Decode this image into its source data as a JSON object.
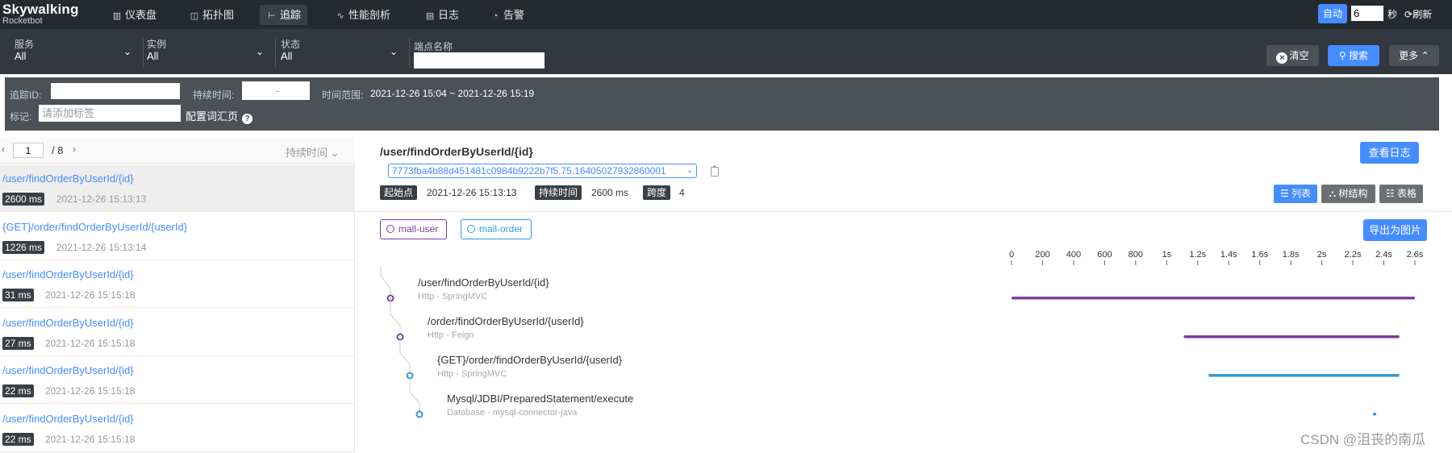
{
  "app": {
    "logo_line1": "Skywalking",
    "logo_line2": "Rocketbot"
  },
  "nav": [
    {
      "icon": "dashboard-icon",
      "glyph": "▥",
      "label": "仪表盘",
      "active": false
    },
    {
      "icon": "topology-icon",
      "glyph": "◫",
      "label": "拓扑图",
      "active": false
    },
    {
      "icon": "trace-icon",
      "glyph": "⊢",
      "label": "追踪",
      "active": true
    },
    {
      "icon": "profile-icon",
      "glyph": "∿",
      "label": "性能剖析",
      "active": false
    },
    {
      "icon": "log-icon",
      "glyph": "▤",
      "label": "日志",
      "active": false
    },
    {
      "icon": "alarm-icon",
      "glyph": "◔",
      "label": "告警",
      "active": false
    }
  ],
  "topright": {
    "auto_label": "自动",
    "interval_value": "6",
    "sec_label": "秒",
    "refresh_label": "刷新"
  },
  "filters": {
    "service": {
      "label": "服务",
      "value": "All"
    },
    "instance": {
      "label": "实例",
      "value": "All"
    },
    "status": {
      "label": "状态",
      "value": "All"
    },
    "endpoint_label": "端点名称",
    "endpoint_value": "",
    "clear_label": "清空",
    "search_label": "搜索",
    "more_label": "更多"
  },
  "advanced": {
    "trace_id_label": "追踪ID:",
    "trace_id_value": "",
    "duration_label": "持续时间:",
    "duration_placeholder": "-",
    "time_range_label": "时间范围:",
    "time_range_value": "2021-12-26 15:04 ~ 2021-12-26 15:19",
    "tags_label": "标记:",
    "tags_placeholder": "请添加标签",
    "config_link": "配置词汇页"
  },
  "list": {
    "page": "1",
    "total": "/ 8",
    "sort_label": "持续时间",
    "traces": [
      {
        "name": "/user/findOrderByUserId/{id}",
        "duration": "2600 ms",
        "time": "2021-12-26 15:13:13",
        "selected": true
      },
      {
        "name": "{GET}/order/findOrderByUserId/{userId}",
        "duration": "1226 ms",
        "time": "2021-12-26 15:13:14",
        "selected": false
      },
      {
        "name": "/user/findOrderByUserId/{id}",
        "duration": "31 ms",
        "time": "2021-12-26 15:15:18",
        "selected": false
      },
      {
        "name": "/user/findOrderByUserId/{id}",
        "duration": "27 ms",
        "time": "2021-12-26 15:15:18",
        "selected": false
      },
      {
        "name": "/user/findOrderByUserId/{id}",
        "duration": "22 ms",
        "time": "2021-12-26 15:15:18",
        "selected": false
      },
      {
        "name": "/user/findOrderByUserId/{id}",
        "duration": "22 ms",
        "time": "2021-12-26 15:15:18",
        "selected": false
      }
    ]
  },
  "detail": {
    "title": "/user/findOrderByUserId/{id}",
    "trace_id": "7773fba4b88d451481c0984b9222b7f5.75.16405027932860001",
    "start_label": "起始点",
    "start_value": "2021-12-26 15:13:13",
    "duration_label": "持续时间",
    "duration_value": "2600 ms",
    "span_label": "跨度",
    "span_value": "4",
    "view_logs_label": "查看日志",
    "views": [
      {
        "label": "列表",
        "icon": "list-icon",
        "active": true
      },
      {
        "label": "树结构",
        "icon": "tree-icon",
        "active": false
      },
      {
        "label": "表格",
        "icon": "table-icon",
        "active": false
      }
    ],
    "services": [
      {
        "name": "mall-user",
        "color": "#7b3fa0"
      },
      {
        "name": "mall-order",
        "color": "#2d9cdb"
      }
    ],
    "export_label": "导出为图片"
  },
  "chart_data": {
    "type": "gantt",
    "axis_unit": "ms",
    "ticks": [
      {
        "value": 0,
        "label": "0"
      },
      {
        "value": 200,
        "label": "200"
      },
      {
        "value": 400,
        "label": "400"
      },
      {
        "value": 600,
        "label": "600"
      },
      {
        "value": 800,
        "label": "800"
      },
      {
        "value": 1000,
        "label": "1s"
      },
      {
        "value": 1200,
        "label": "1.2s"
      },
      {
        "value": 1400,
        "label": "1.4s"
      },
      {
        "value": 1600,
        "label": "1.6s"
      },
      {
        "value": 1800,
        "label": "1.8s"
      },
      {
        "value": 2000,
        "label": "2s"
      },
      {
        "value": 2200,
        "label": "2.2s"
      },
      {
        "value": 2400,
        "label": "2.4s"
      },
      {
        "value": 2600,
        "label": "2.6s"
      }
    ],
    "xlim": [
      0,
      2600
    ],
    "spans": [
      {
        "name": "/user/findOrderByUserId/{id}",
        "type": "Http - SpringMVC",
        "start": 0,
        "end": 2600,
        "depth": 0,
        "color": "#7b3fa0"
      },
      {
        "name": "/order/findOrderByUserId/{userId}",
        "type": "Http - Feign",
        "start": 1110,
        "end": 2500,
        "depth": 1,
        "color": "#7b3fa0"
      },
      {
        "name": "{GET}/order/findOrderByUserId/{userId}",
        "type": "Http - SpringMVC",
        "start": 1270,
        "end": 2500,
        "depth": 2,
        "color": "#2d9cdb"
      },
      {
        "name": "Mysql/JDBI/PreparedStatement/execute",
        "type": "Database - mysql-connector-java",
        "start": 2330,
        "end": 2345,
        "depth": 3,
        "color": "#2d9cdb"
      }
    ]
  },
  "watermark": "CSDN @沮丧的南瓜"
}
